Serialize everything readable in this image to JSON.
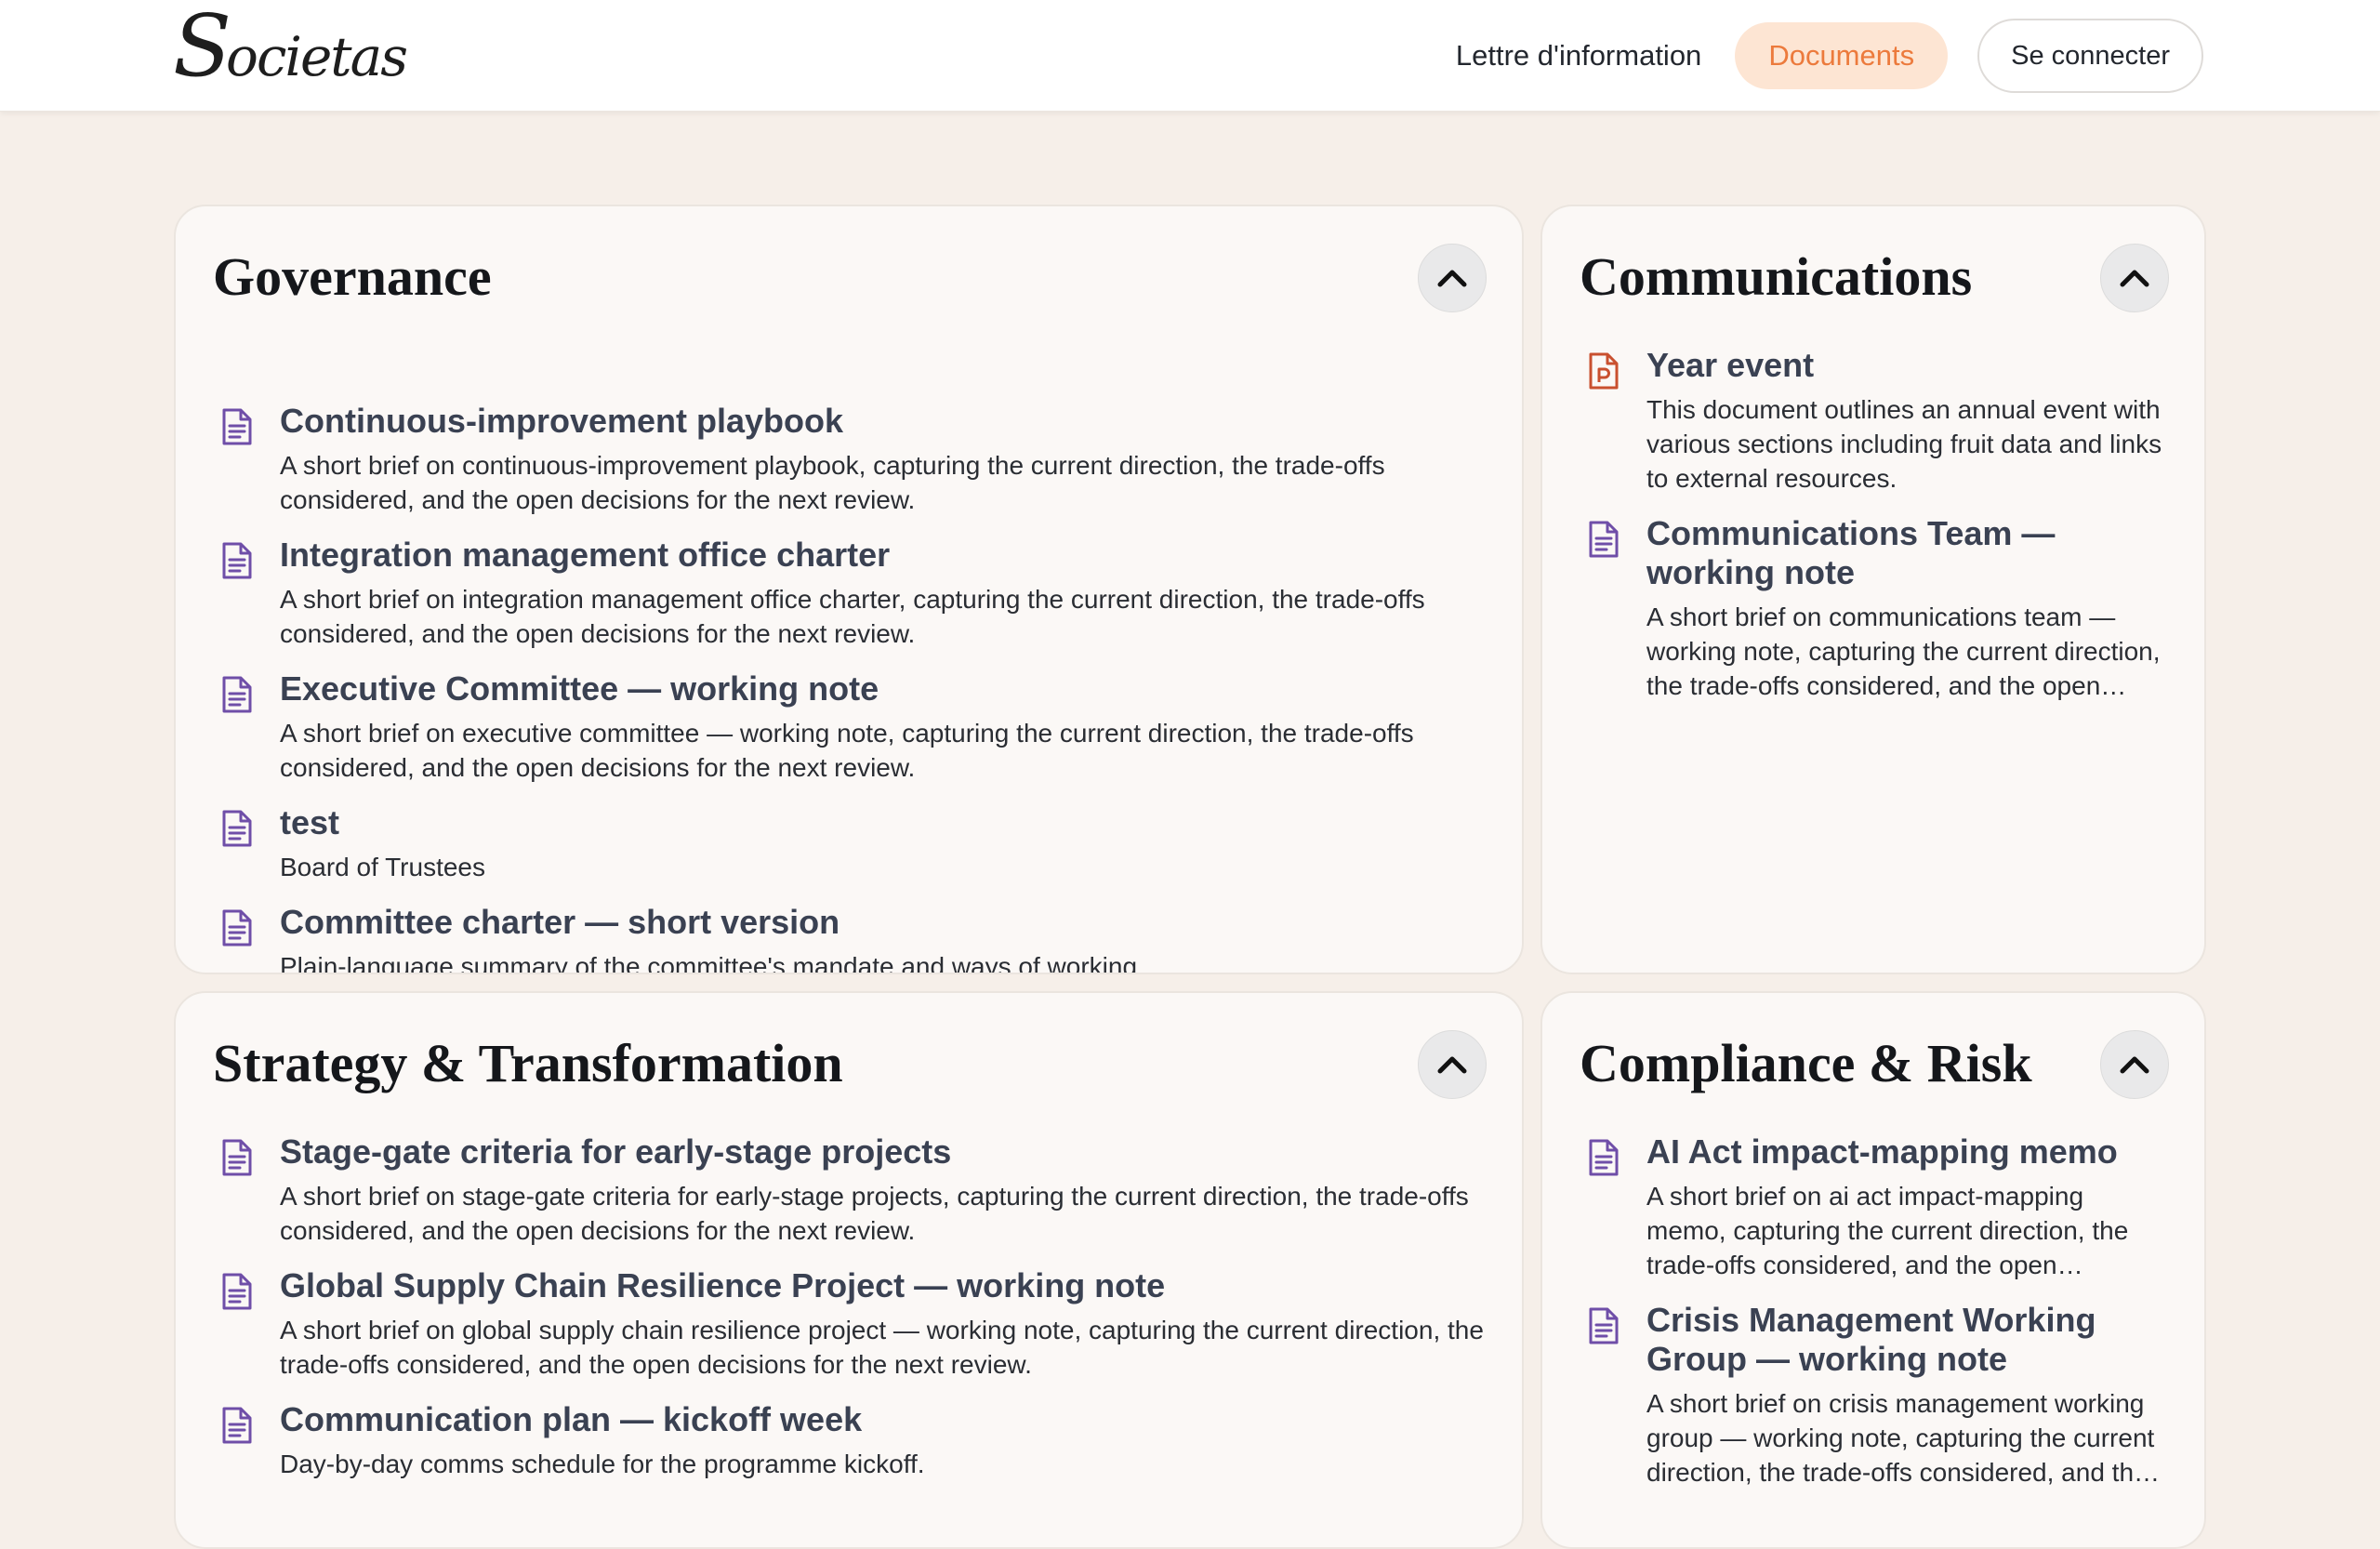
{
  "header": {
    "logo_text": "Societas",
    "nav": [
      {
        "label": "Lettre d'information",
        "active": false
      },
      {
        "label": "Documents",
        "active": true
      }
    ],
    "login_label": "Se connecter"
  },
  "colors": {
    "accent": "#ec7a3c",
    "accent_bg": "#fde5d3",
    "doc_icon": "#6f4ea8",
    "ppt_icon": "#c9502f",
    "title_text": "#3a4152"
  },
  "sections": [
    {
      "title": "Governance",
      "docs": [
        {
          "icon": "text-document-icon",
          "title": "Continuous-improvement playbook",
          "desc": "A short brief on continuous-improvement playbook, capturing the current direction, the trade-offs considered, and the open decisions for the next review."
        },
        {
          "icon": "text-document-icon",
          "title": "Integration management office charter",
          "desc": "A short brief on integration management office charter, capturing the current direction, the trade-offs considered, and the open decisions for the next review."
        },
        {
          "icon": "text-document-icon",
          "title": "Executive Committee — working note",
          "desc": "A short brief on executive committee — working note, capturing the current direction, the trade-offs considered, and the open decisions for the next review."
        },
        {
          "icon": "text-document-icon",
          "title": "test",
          "desc": "Board of Trustees"
        },
        {
          "icon": "text-document-icon",
          "title": "Committee charter — short version",
          "desc": "Plain-language summary of the committee's mandate and ways of working."
        }
      ]
    },
    {
      "title": "Communications",
      "docs": [
        {
          "icon": "presentation-document-icon",
          "title": "Year event",
          "desc": "This document outlines an annual event with various sections including fruit data and links to external resources."
        },
        {
          "icon": "text-document-icon",
          "title": "Communications Team — working note",
          "desc": "A short brief on communications team — working note, capturing the current direction, the trade-offs considered, and the open decisions for the next review."
        }
      ]
    },
    {
      "title": "Strategy & Transformation",
      "docs": [
        {
          "icon": "text-document-icon",
          "title": "Stage-gate criteria for early-stage projects",
          "desc": "A short brief on stage-gate criteria for early-stage projects, capturing the current direction, the trade-offs considered, and the open decisions for the next review."
        },
        {
          "icon": "text-document-icon",
          "title": "Global Supply Chain Resilience Project — working note",
          "desc": "A short brief on global supply chain resilience project — working note, capturing the current direction, the trade-offs considered, and the open decisions for the next review."
        },
        {
          "icon": "text-document-icon",
          "title": "Communication plan — kickoff week",
          "desc": "Day-by-day comms schedule for the programme kickoff."
        }
      ]
    },
    {
      "title": "Compliance & Risk",
      "docs": [
        {
          "icon": "text-document-icon",
          "title": "AI Act impact-mapping memo",
          "desc": "A short brief on ai act impact-mapping memo, capturing the current direction, the trade-offs considered, and the open decisions for the next review."
        },
        {
          "icon": "text-document-icon",
          "title": "Crisis Management Working Group — working note",
          "desc": "A short brief on crisis management working group — working note, capturing the current direction, the trade-offs considered, and the open decisions for the next review."
        }
      ]
    }
  ]
}
